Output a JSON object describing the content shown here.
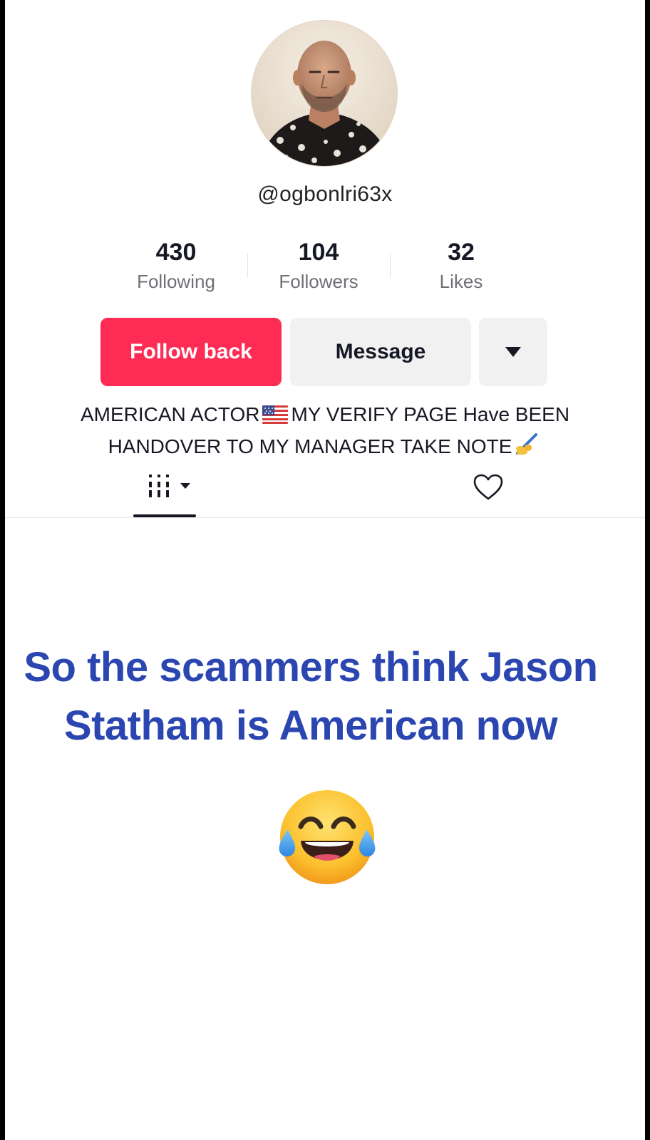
{
  "profile": {
    "username": "@ogbonlri63x",
    "avatar": "avatar-photo"
  },
  "stats": {
    "following": {
      "value": "430",
      "label": "Following"
    },
    "followers": {
      "value": "104",
      "label": "Followers"
    },
    "likes": {
      "value": "32",
      "label": "Likes"
    }
  },
  "actions": {
    "follow_back_label": "Follow back",
    "message_label": "Message",
    "more_icon": "caret-down-icon"
  },
  "bio": {
    "line1_before": "AMERICAN ACTOR",
    "line1_after": "MY VERIFY PAGE Have BEEN",
    "line2": "HANDOVER TO MY MANAGER TAKE NOTE",
    "emojis": [
      "us-flag-emoji",
      "writing-hand-emoji"
    ]
  },
  "tabs": [
    {
      "name": "videos-tab",
      "icon": "videos-grid-icon",
      "active": true
    },
    {
      "name": "liked-tab",
      "icon": "heart-icon",
      "active": false
    }
  ],
  "caption": {
    "line1": "So the scammers think Jason",
    "line2": "Statham is American now",
    "emoji": "face-with-tears-of-joy-emoji"
  },
  "colors": {
    "follow_button": "#fe2c55",
    "secondary_button": "#f1f1f2",
    "caption_text": "#2b46b1"
  }
}
